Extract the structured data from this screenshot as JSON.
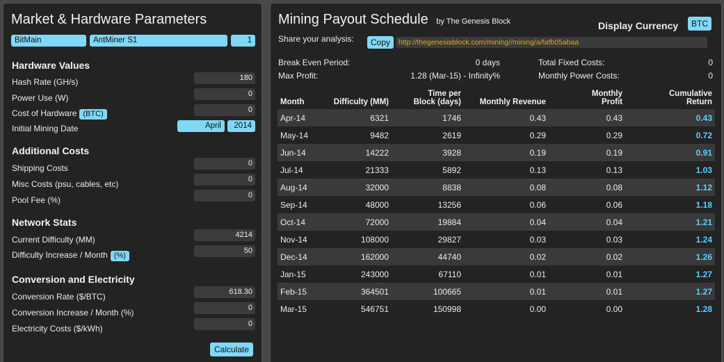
{
  "left": {
    "title": "Market & Hardware Parameters",
    "manufacturer": "BitMain",
    "model": "AntMiner S1",
    "quantity": "1",
    "hardware": {
      "heading": "Hardware Values",
      "hash_rate_label": "Hash Rate (GH/s)",
      "hash_rate_value": "180",
      "power_label": "Power Use (W)",
      "power_value": "0",
      "cost_label": "Cost of Hardware",
      "cost_unit": "(BTC)",
      "cost_value": "0",
      "date_label": "Initial Mining Date",
      "date_month": "April",
      "date_year": "2014"
    },
    "additional": {
      "heading": "Additional Costs",
      "shipping_label": "Shipping Costs",
      "shipping_value": "0",
      "misc_label": "Misc Costs (psu, cables, etc)",
      "misc_value": "0",
      "pool_label": "Pool Fee (%)",
      "pool_value": "0"
    },
    "network": {
      "heading": "Network Stats",
      "difficulty_label": "Current Difficulty (MM)",
      "difficulty_value": "4214",
      "increase_label": "Difficulty Increase / Month",
      "increase_unit": "(%)",
      "increase_value": "50"
    },
    "conversion": {
      "heading": "Conversion and Electricity",
      "rate_label": "Conversion Rate ($/BTC)",
      "rate_value": "618.30",
      "rate_increase_label": "Conversion Increase / Month (%)",
      "rate_increase_value": "0",
      "electricity_label": "Electricity Costs ($/kWh)",
      "electricity_value": "0"
    },
    "calculate_label": "Calculate"
  },
  "right": {
    "title": "Mining Payout Schedule",
    "byline": "by The Genesis Block",
    "currency_label": "Display Currency",
    "currency_value": "BTC",
    "share_label": "Share your analysis:",
    "copy_label": "Copy",
    "share_url": "http://thegenesisblock.com/mining//mining/a/fafb05abaa",
    "summary": {
      "break_even_label": "Break Even Period:",
      "break_even_value": "0 days",
      "max_profit_label": "Max Profit:",
      "max_profit_value": "1.28 (Mar-15) - Infinity%",
      "fixed_costs_label": "Total Fixed Costs:",
      "fixed_costs_value": "0",
      "power_costs_label": "Monthly Power Costs:",
      "power_costs_value": "0"
    },
    "columns": {
      "month": "Month",
      "difficulty": "Difficulty (MM)",
      "time_line1": "Time per",
      "time_line2": "Block (days)",
      "revenue": "Monthly Revenue",
      "profit_line1": "Monthly",
      "profit_line2": "Profit",
      "cum_line1": "Cumulative",
      "cum_line2": "Return"
    },
    "rows": [
      {
        "month": "Apr-14",
        "difficulty": "6321",
        "time": "1746",
        "revenue": "0.43",
        "profit": "0.43",
        "cumulative": "0.43"
      },
      {
        "month": "May-14",
        "difficulty": "9482",
        "time": "2619",
        "revenue": "0.29",
        "profit": "0.29",
        "cumulative": "0.72"
      },
      {
        "month": "Jun-14",
        "difficulty": "14222",
        "time": "3928",
        "revenue": "0.19",
        "profit": "0.19",
        "cumulative": "0.91"
      },
      {
        "month": "Jul-14",
        "difficulty": "21333",
        "time": "5892",
        "revenue": "0.13",
        "profit": "0.13",
        "cumulative": "1.03"
      },
      {
        "month": "Aug-14",
        "difficulty": "32000",
        "time": "8838",
        "revenue": "0.08",
        "profit": "0.08",
        "cumulative": "1.12"
      },
      {
        "month": "Sep-14",
        "difficulty": "48000",
        "time": "13256",
        "revenue": "0.06",
        "profit": "0.06",
        "cumulative": "1.18"
      },
      {
        "month": "Oct-14",
        "difficulty": "72000",
        "time": "19884",
        "revenue": "0.04",
        "profit": "0.04",
        "cumulative": "1.21"
      },
      {
        "month": "Nov-14",
        "difficulty": "108000",
        "time": "29827",
        "revenue": "0.03",
        "profit": "0.03",
        "cumulative": "1.24"
      },
      {
        "month": "Dec-14",
        "difficulty": "162000",
        "time": "44740",
        "revenue": "0.02",
        "profit": "0.02",
        "cumulative": "1.26"
      },
      {
        "month": "Jan-15",
        "difficulty": "243000",
        "time": "67110",
        "revenue": "0.01",
        "profit": "0.01",
        "cumulative": "1.27"
      },
      {
        "month": "Feb-15",
        "difficulty": "364501",
        "time": "100665",
        "revenue": "0.01",
        "profit": "0.01",
        "cumulative": "1.27"
      },
      {
        "month": "Mar-15",
        "difficulty": "546751",
        "time": "150998",
        "revenue": "0.00",
        "profit": "0.00",
        "cumulative": "1.28"
      }
    ]
  },
  "colors": {
    "accent": "#7fd9f6",
    "cumulative": "#5ccfff",
    "url_text": "#e8a800",
    "panel_bg": "#232323",
    "page_bg": "#484848"
  }
}
